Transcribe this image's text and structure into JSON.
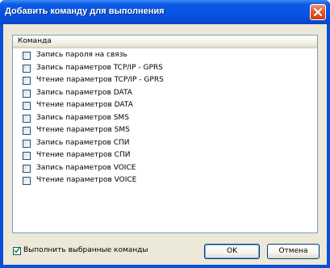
{
  "window": {
    "title": "Добавить команду для выполнения"
  },
  "list": {
    "column_header": "Команда",
    "items": [
      {
        "label": "Запись пароля на связь",
        "checked": false
      },
      {
        "label": "Запись параметров TCP/IP - GPRS",
        "checked": false
      },
      {
        "label": "Чтение параметров TCP/IP - GPRS",
        "checked": false
      },
      {
        "label": "Запись параметров DATA",
        "checked": false
      },
      {
        "label": "Чтение параметров DATA",
        "checked": false
      },
      {
        "label": "Запись параметров SMS",
        "checked": false
      },
      {
        "label": "Чтение параметров SMS",
        "checked": false
      },
      {
        "label": "Запись параметров СПИ",
        "checked": false
      },
      {
        "label": "Чтение параметров СПИ",
        "checked": false
      },
      {
        "label": "Запись параметров VOICE",
        "checked": false
      },
      {
        "label": "Чтение параметров VOICE",
        "checked": false
      }
    ]
  },
  "execute_selected": {
    "label": "Выполнить выбранные команды",
    "checked": true
  },
  "buttons": {
    "ok_label": "OK",
    "cancel_label": "Отмена"
  },
  "colors": {
    "titlebar": "#0553e0",
    "dialog_face": "#ece9d8",
    "close_button": "#e25a32"
  }
}
